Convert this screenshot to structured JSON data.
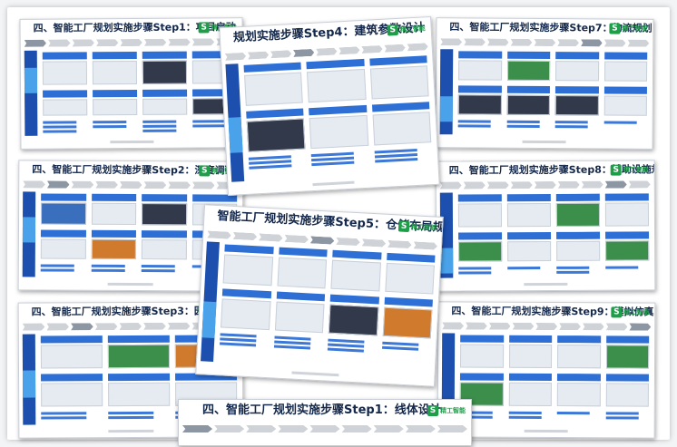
{
  "slides": [
    {
      "id": "s1",
      "title": "四、智能工厂规划实施步骤Step1：项目启动"
    },
    {
      "id": "s2",
      "title": "四、智能工厂规划实施步骤Step2：深度调研"
    },
    {
      "id": "s3",
      "title": "四、智能工厂规划实施步骤Step3：园区整体规"
    },
    {
      "id": "s4",
      "title": "规划实施步骤Step4：建筑参数设计"
    },
    {
      "id": "s5",
      "title": "智能工厂规划实施步骤Step5：仓储布局规划"
    },
    {
      "id": "s6",
      "title": "四、智能工厂规划实施步骤Step1：线体设计"
    },
    {
      "id": "s7",
      "title": "四、智能工厂规划实施步骤Step7：物流规划"
    },
    {
      "id": "s8",
      "title": "四、智能工厂规划实施步骤Step8：辅助设施规划"
    },
    {
      "id": "s9",
      "title": "四、智能工厂规划实施步骤Step9：模拟仿真"
    }
  ],
  "logo": {
    "mark": "S",
    "text": "精工智能"
  },
  "colors": {
    "accent": "#2e6fd6",
    "sidebar": "#1c4fae",
    "brand": "#1f9e4a"
  }
}
